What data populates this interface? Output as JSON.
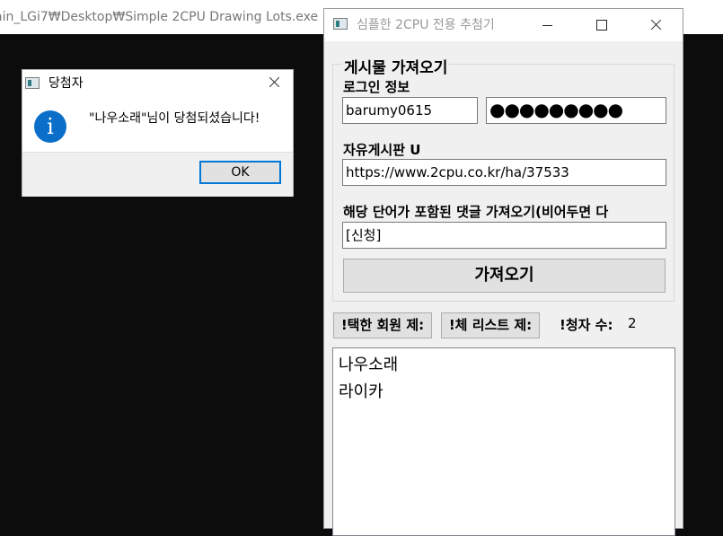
{
  "console": {
    "title": "ain_LGi7₩Desktop₩Simple 2CPU Drawing Lots.exe"
  },
  "main_window": {
    "title": "심플한 2CPU 전용 추첨기",
    "group_title": "게시물 가져오기",
    "login_label": "로그인 정보",
    "username": "barumy0615",
    "password_mask": "●●●●●●●●●",
    "board_label": "자유게시판 U",
    "board_url": "https://www.2cpu.co.kr/ha/37533",
    "filter_label": "해당 단어가 포함된 댓글 가져오기(비어두면 다",
    "filter_value": "[신청]",
    "fetch_button": "가져오기",
    "remove_selected_button": "!택한 회원 제:",
    "clear_list_button": "!체 리스트 제:",
    "applicant_count_label": "!청자 수:",
    "applicant_count": "2",
    "applicants": [
      "나우소래",
      "라이카"
    ]
  },
  "message_box": {
    "title": "당첨자",
    "message": "\"나우소래\"님이 당첨되셨습니다!",
    "ok_button": "OK",
    "icon": "information-icon"
  },
  "colors": {
    "accent": "#0078d7",
    "info_icon": "#0b6fc9",
    "console_bg": "#0c0c0c"
  }
}
